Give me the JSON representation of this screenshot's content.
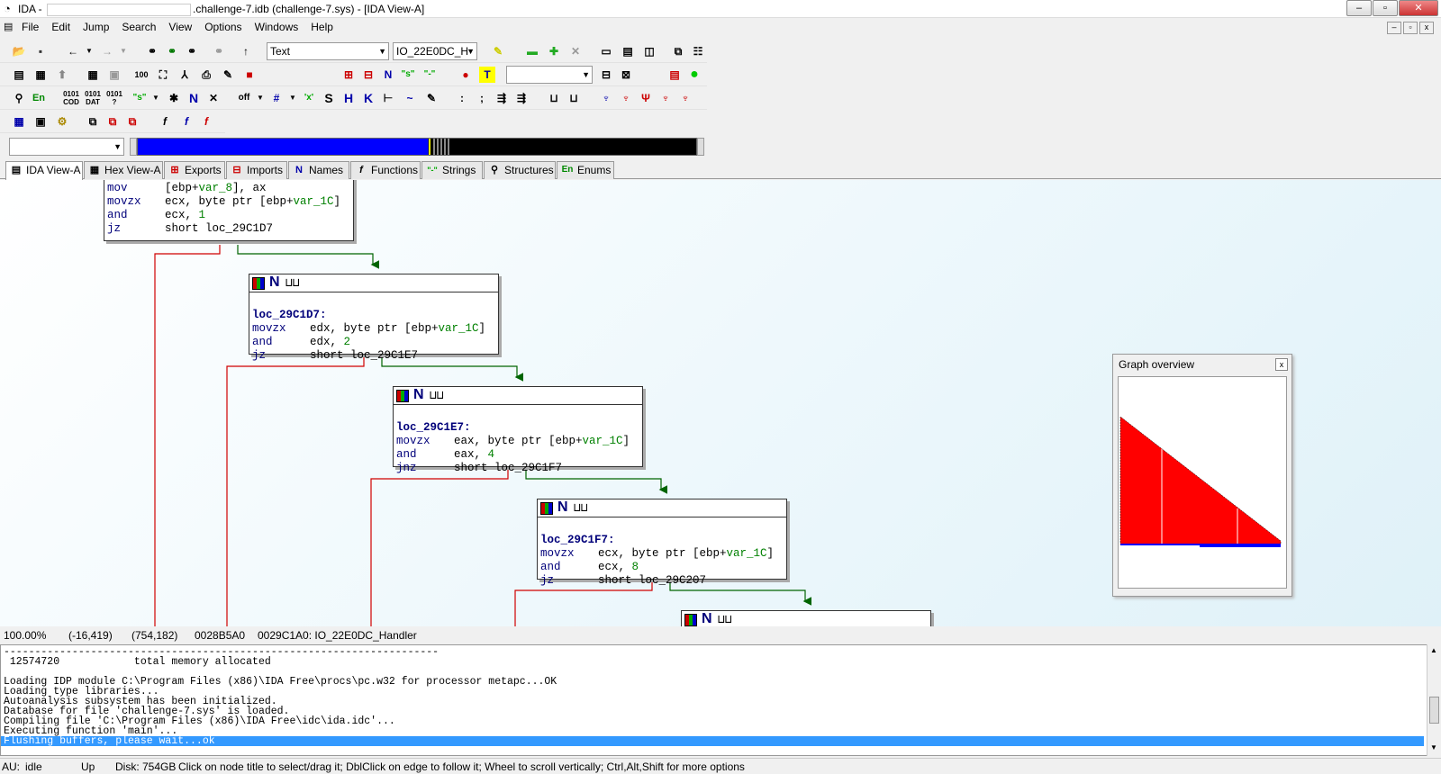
{
  "window": {
    "app": "IDA -",
    "title_suffix": ".challenge-7.idb (challenge-7.sys) - [IDA View-A]",
    "minimize": "–",
    "restore": "▫",
    "close": "✕"
  },
  "menu": [
    "File",
    "Edit",
    "Jump",
    "Search",
    "View",
    "Options",
    "Windows",
    "Help"
  ],
  "toolbar": {
    "text_combo": "Text",
    "function_combo": "IO_22E0DC_H",
    "empty_combo": ""
  },
  "tabs": [
    {
      "label": "IDA View-A",
      "icon": "ida-view-icon"
    },
    {
      "label": "Hex View-A",
      "icon": "hex-view-icon"
    },
    {
      "label": "Exports",
      "icon": "exports-icon"
    },
    {
      "label": "Imports",
      "icon": "imports-icon"
    },
    {
      "label": "Names",
      "icon": "names-icon"
    },
    {
      "label": "Functions",
      "icon": "functions-icon"
    },
    {
      "label": "Strings",
      "icon": "strings-icon"
    },
    {
      "label": "Structures",
      "icon": "structures-icon"
    },
    {
      "label": "Enums",
      "icon": "enums-icon"
    }
  ],
  "nodes": [
    {
      "id": "block-0",
      "label": "",
      "lines": [
        {
          "m": "mov",
          "o": "[ebp+var_8], ax"
        },
        {
          "m": "movzx",
          "o": "ecx, byte ptr [ebp+var_1C]"
        },
        {
          "m": "and",
          "o": "ecx, 1"
        },
        {
          "m": "jz",
          "o": "short loc_29C1D7"
        }
      ]
    },
    {
      "id": "block-1",
      "label": "loc_29C1D7:",
      "lines": [
        {
          "m": "movzx",
          "o": "edx, byte ptr [ebp+var_1C]"
        },
        {
          "m": "and",
          "o": "edx, 2"
        },
        {
          "m": "jz",
          "o": "short loc_29C1E7"
        }
      ]
    },
    {
      "id": "block-2",
      "label": "loc_29C1E7:",
      "lines": [
        {
          "m": "movzx",
          "o": "eax, byte ptr [ebp+var_1C]"
        },
        {
          "m": "and",
          "o": "eax, 4"
        },
        {
          "m": "jnz",
          "o": "short loc_29C1F7"
        }
      ]
    },
    {
      "id": "block-3",
      "label": "loc_29C1F7:",
      "lines": [
        {
          "m": "movzx",
          "o": "ecx, byte ptr [ebp+var_1C]"
        },
        {
          "m": "and",
          "o": "ecx, 8"
        },
        {
          "m": "jz",
          "o": "short loc_29C207"
        }
      ]
    }
  ],
  "overview": {
    "title": "Graph overview",
    "close": "x"
  },
  "status": {
    "zoom": "100.00%",
    "coord1": "(-16,419)",
    "coord2": "(754,182)",
    "offset": "0028B5A0",
    "location": "0029C1A0: IO_22E0DC_Handler"
  },
  "output_lines": [
    "----------------------------------------------------------------------",
    " 12574720            total memory allocated",
    "",
    "Loading IDP module C:\\Program Files (x86)\\IDA Free\\procs\\pc.w32 for processor metapc...OK",
    "Loading type libraries...",
    "Autoanalysis subsystem has been initialized.",
    "Database for file 'challenge-7.sys' is loaded.",
    "Compiling file 'C:\\Program Files (x86)\\IDA Free\\idc\\ida.idc'...",
    "Executing function 'main'...",
    "Flushing buffers, please wait...ok"
  ],
  "bottom": {
    "au": "AU:",
    "state": "idle",
    "dir": "Up",
    "disk": "Disk: 754GB",
    "hint": "Click on node title to select/drag it; DblClick on edge to follow it; Wheel to scroll vertically; Ctrl,Alt,Shift for more options"
  }
}
